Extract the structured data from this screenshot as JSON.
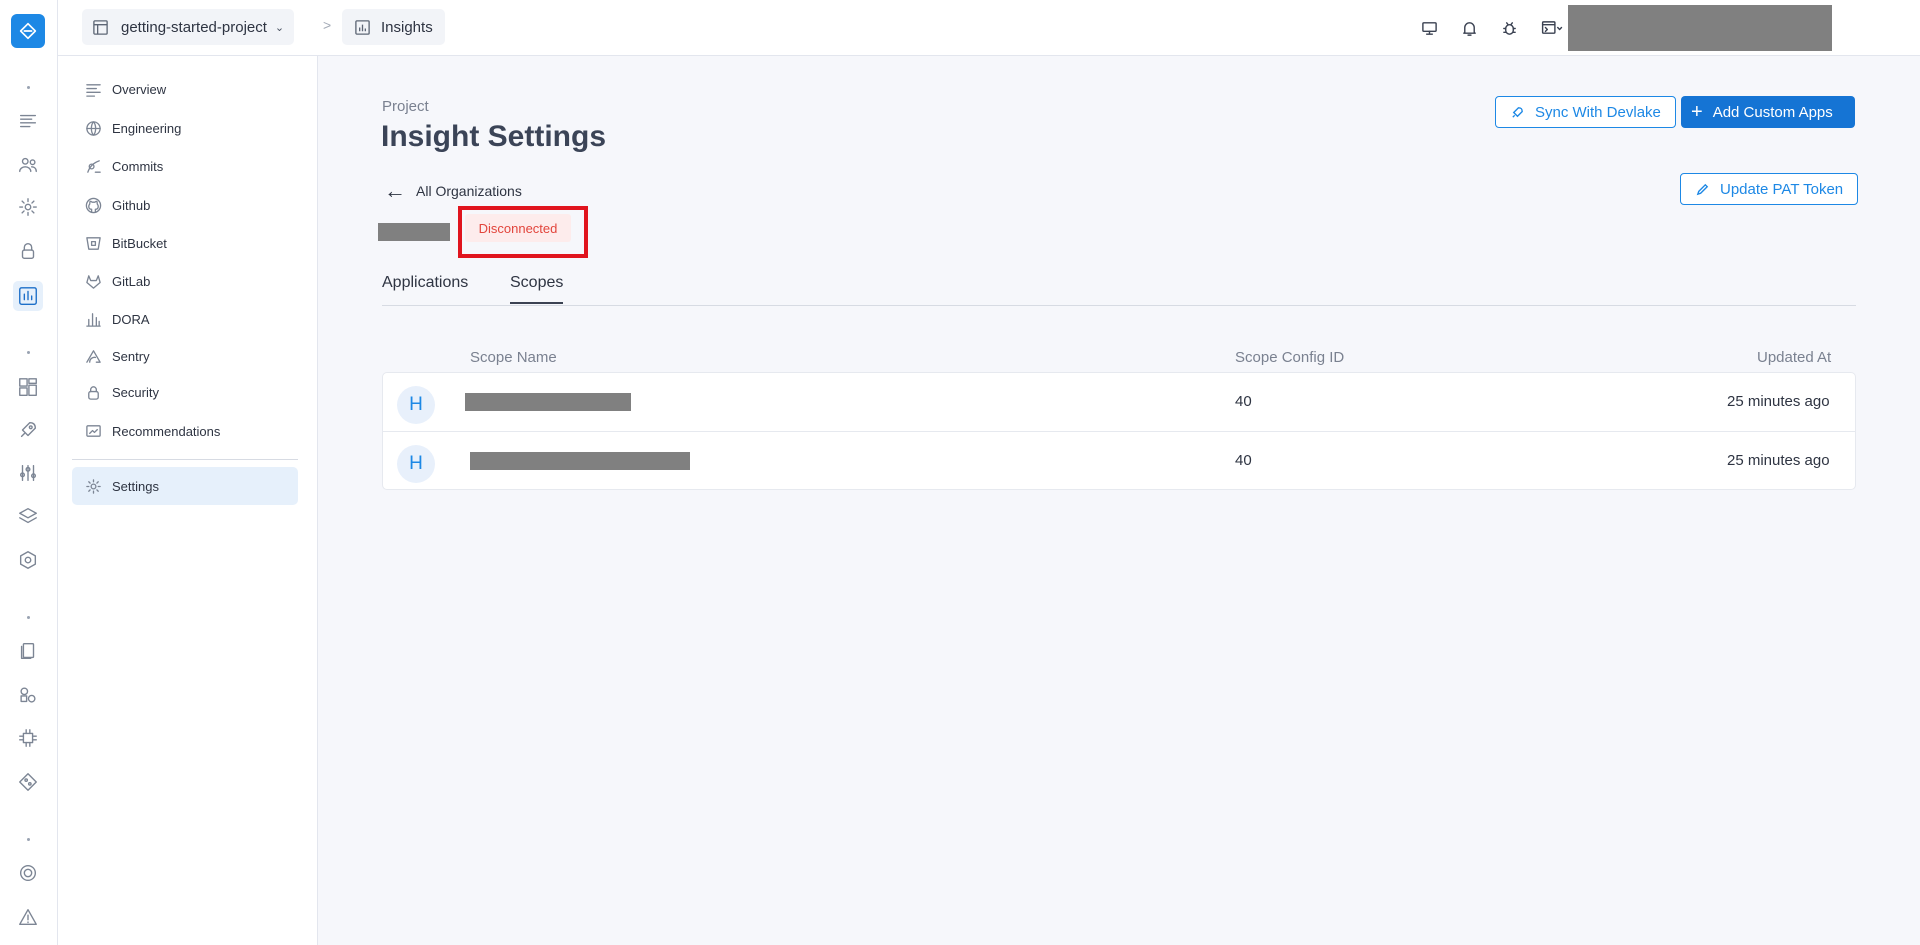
{
  "topbar": {
    "project_name": "getting-started-project",
    "breadcrumb_separator": ">",
    "page_name": "Insights"
  },
  "sidebar": {
    "items": [
      {
        "label": "Overview",
        "icon": "lines-icon"
      },
      {
        "label": "Engineering",
        "icon": "globe-icon"
      },
      {
        "label": "Commits",
        "icon": "commit-icon"
      },
      {
        "label": "Github",
        "icon": "github-icon"
      },
      {
        "label": "BitBucket",
        "icon": "bitbucket-icon"
      },
      {
        "label": "GitLab",
        "icon": "gitlab-icon"
      },
      {
        "label": "DORA",
        "icon": "chart-icon"
      },
      {
        "label": "Sentry",
        "icon": "sentry-icon"
      },
      {
        "label": "Security",
        "icon": "lock-icon"
      },
      {
        "label": "Recommendations",
        "icon": "recommend-icon"
      }
    ],
    "settings_label": "Settings"
  },
  "header": {
    "eyebrow": "Project",
    "title": "Insight Settings",
    "sync_button": "Sync With Devlake",
    "add_button": "Add Custom Apps",
    "update_pat_button": "Update PAT Token",
    "back_link": "All Organizations",
    "status": "Disconnected"
  },
  "tabs": [
    "Applications",
    "Scopes"
  ],
  "active_tab": "Scopes",
  "table": {
    "columns": [
      "Scope Name",
      "Scope Config ID",
      "Updated At"
    ],
    "rows": [
      {
        "avatar": "H",
        "config_id": "40",
        "updated_at": "25 minutes ago"
      },
      {
        "avatar": "H",
        "config_id": "40",
        "updated_at": "25 minutes ago"
      }
    ]
  },
  "colors": {
    "accent": "#1d88e5",
    "primary_button": "#1574d4",
    "status_red": "#e2453c",
    "highlight_red": "#e0141e"
  }
}
